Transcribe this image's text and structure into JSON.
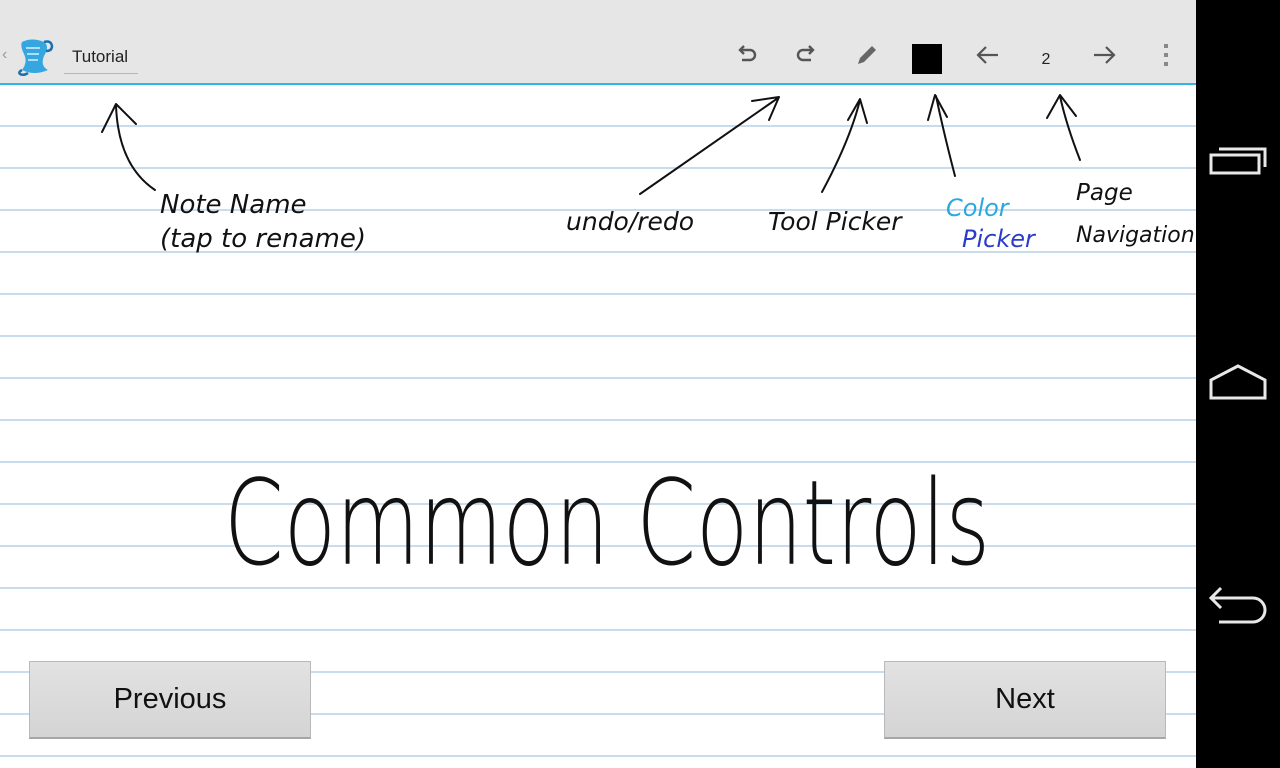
{
  "action_bar": {
    "note_title": "Tutorial",
    "page_number": "2",
    "icons": [
      "app-logo-icon",
      "undo-icon",
      "redo-icon",
      "pencil-icon",
      "color-swatch",
      "arrow-left-icon",
      "arrow-right-icon",
      "overflow-menu-icon"
    ],
    "accent_color": "#33b5e5",
    "selected_color": "#000000"
  },
  "annotations": {
    "note_name_line1": "Note Name",
    "note_name_line2": "(tap to rename)",
    "undo_redo": "undo/redo",
    "tool_picker": "Tool Picker",
    "color_picker_line1": "Color",
    "color_picker_line2": "Picker",
    "page_navigation_line1": "Page",
    "page_navigation_line2": "Navigation",
    "headline": "Common Controls"
  },
  "buttons": {
    "previous": "Previous",
    "next": "Next"
  },
  "nav_bar": {
    "icons": [
      "recent-apps-icon",
      "home-icon",
      "back-icon"
    ]
  }
}
